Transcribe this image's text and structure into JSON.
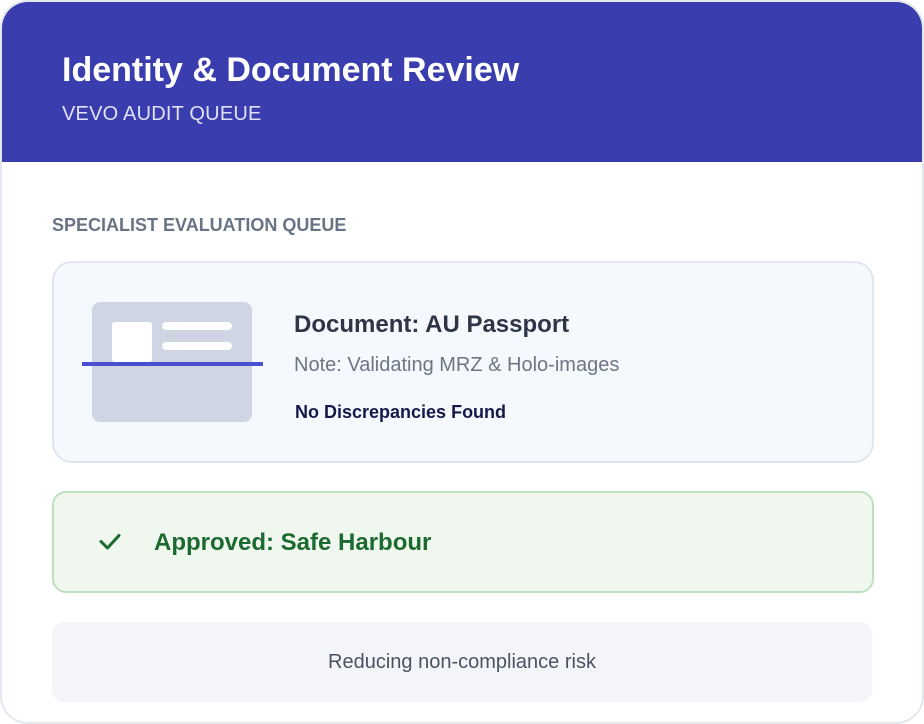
{
  "header": {
    "title": "Identity & Document Review",
    "subtitle": "VEVO AUDIT QUEUE"
  },
  "queue": {
    "label": "SPECIALIST EVALUATION QUEUE"
  },
  "document": {
    "title": "Document: AU Passport",
    "note": "Note: Validating MRZ & Holo-images",
    "status": "No Discrepancies Found",
    "thumbnail_icon": "id-document-icon"
  },
  "result": {
    "icon": "check-icon",
    "text": "Approved: Safe Harbour"
  },
  "footer": {
    "text": "Reducing non-compliance risk"
  },
  "colors": {
    "header_bg": "#3a3dae",
    "approved_text": "#1b6a30",
    "approved_bg": "#eff7ef",
    "scan_line": "#4a4fd0"
  }
}
